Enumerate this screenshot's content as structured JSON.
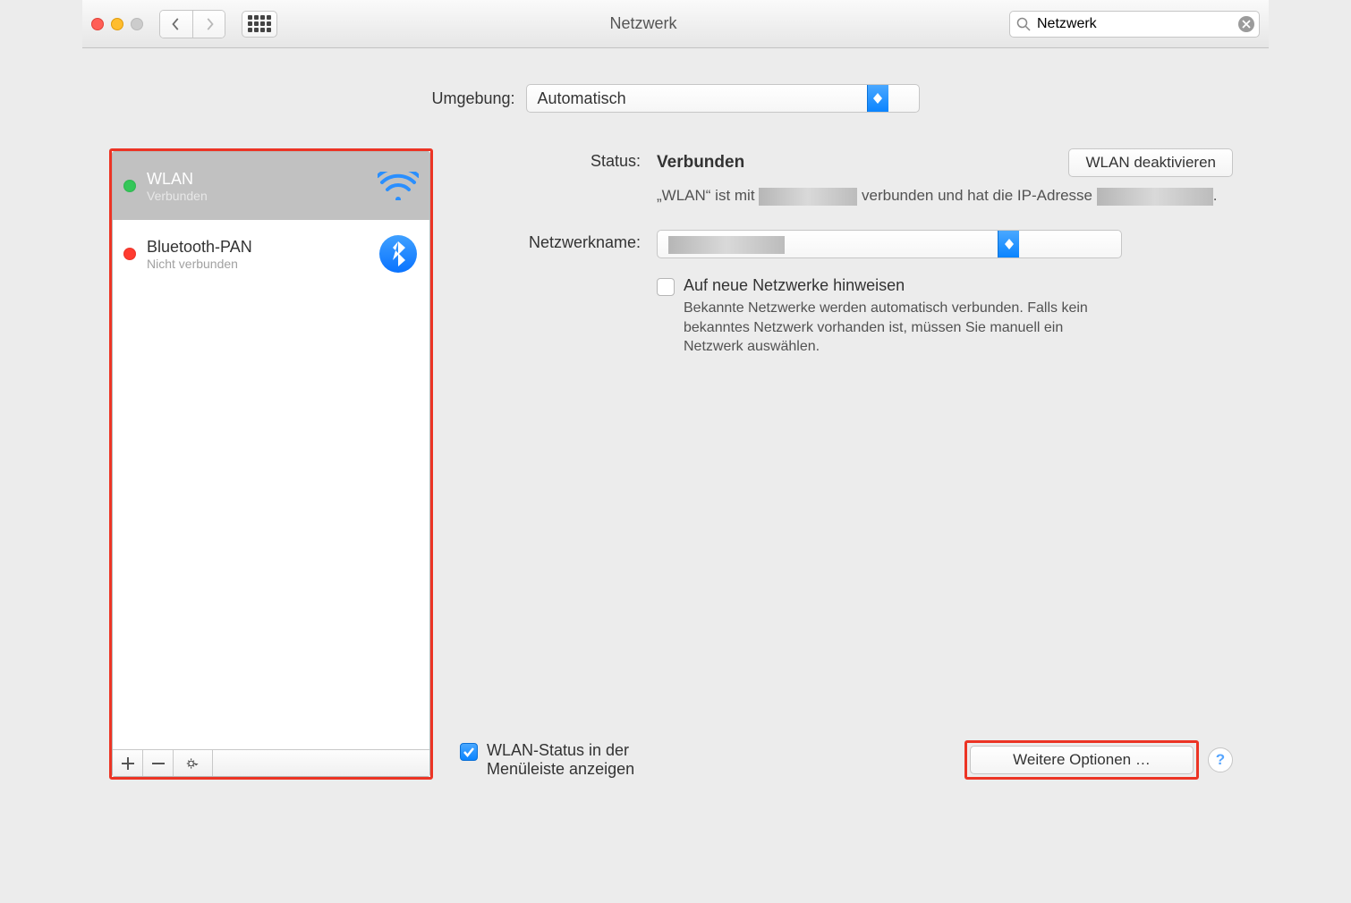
{
  "window": {
    "title": "Netzwerk"
  },
  "toolbar": {
    "search_value": "Netzwerk"
  },
  "umgebung": {
    "label": "Umgebung:",
    "value": "Automatisch"
  },
  "sidebar": {
    "items": [
      {
        "name": "WLAN",
        "sub": "Verbunden",
        "status": "green",
        "icon": "wifi",
        "selected": true
      },
      {
        "name": "Bluetooth-PAN",
        "sub": "Nicht verbunden",
        "status": "red",
        "icon": "bluetooth",
        "selected": false
      }
    ]
  },
  "detail": {
    "status_label": "Status:",
    "status_value": "Verbunden",
    "deactivate_btn": "WLAN deaktivieren",
    "desc_prefix": "„WLAN“ ist mit ",
    "desc_mid": " verbunden und hat die IP-Adresse ",
    "desc_suffix": ".",
    "netzwerkname_label": "Netzwerkname:",
    "netzwerkname_value": "",
    "new_net_label": "Auf neue Netzwerke hinweisen",
    "new_net_hint": "Bekannte Netzwerke werden automatisch verbunden. Falls kein bekanntes Netzwerk vorhanden ist, müssen Sie manuell ein Netzwerk auswählen.",
    "menubar_label": "WLAN-Status in der Menüleiste anzeigen",
    "more_options": "Weitere Optionen …"
  }
}
